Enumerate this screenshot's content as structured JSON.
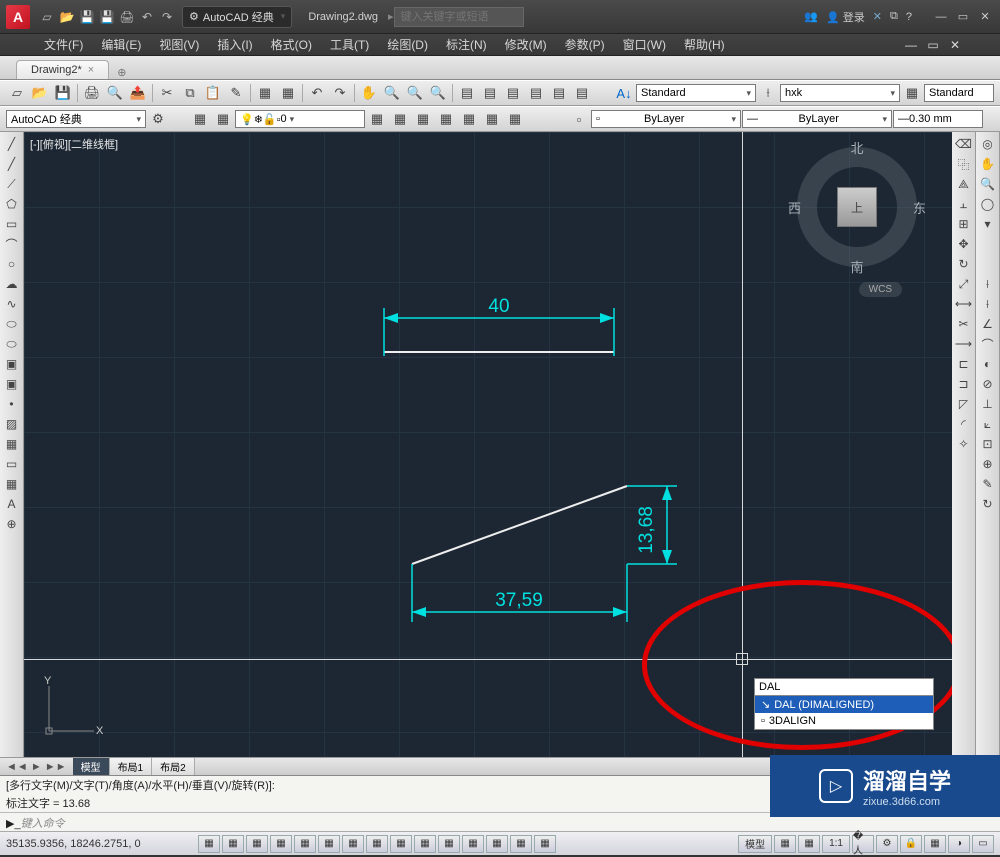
{
  "title": {
    "workspace": "AutoCAD 经典",
    "document": "Drawing2.dwg",
    "search_placeholder": "键入关键字或短语",
    "login": "登录"
  },
  "menus": [
    "文件(F)",
    "编辑(E)",
    "视图(V)",
    "插入(I)",
    "格式(O)",
    "工具(T)",
    "绘图(D)",
    "标注(N)",
    "修改(M)",
    "参数(P)",
    "窗口(W)",
    "帮助(H)"
  ],
  "doc_tab": {
    "label": "Drawing2*"
  },
  "toolbar2_workspace": "AutoCAD 经典",
  "toolbar2_layer": "0",
  "props": {
    "text_style": "Standard",
    "dim_style": "hxk",
    "table_style": "Standard",
    "layer": "ByLayer",
    "linetype": "ByLayer",
    "lineweight": "0.30 mm"
  },
  "viewport": {
    "label": "[-][俯视][二维线框]",
    "compass": {
      "n": "北",
      "s": "南",
      "e": "东",
      "w": "西",
      "top": "上"
    },
    "wcs": "WCS",
    "dim1": "40",
    "dim2": "37,59",
    "dim3": "13,68",
    "ucs_x": "X",
    "ucs_y": "Y"
  },
  "cmd_suggest": {
    "typed": "DAL",
    "options": [
      {
        "label": "DAL (DIMALIGNED)",
        "selected": true
      },
      {
        "label": "3DALIGN",
        "selected": false
      }
    ]
  },
  "layout_tabs": {
    "nav": "◄◄ ► ►►",
    "tabs": [
      "模型",
      "布局1",
      "布局2"
    ]
  },
  "command_window": {
    "line1": "[多行文字(M)/文字(T)/角度(A)/水平(H)/垂直(V)/旋转(R)]:",
    "line2": "标注文字 = 13.68",
    "prompt_placeholder": "键入命令"
  },
  "status": {
    "coords": "35135.9356, 18246.2751, 0",
    "model": "模型",
    "scale": "1:1",
    "annoscale": "▲"
  },
  "watermark": {
    "brand": "溜溜自学",
    "url": "zixue.3d66.com"
  }
}
